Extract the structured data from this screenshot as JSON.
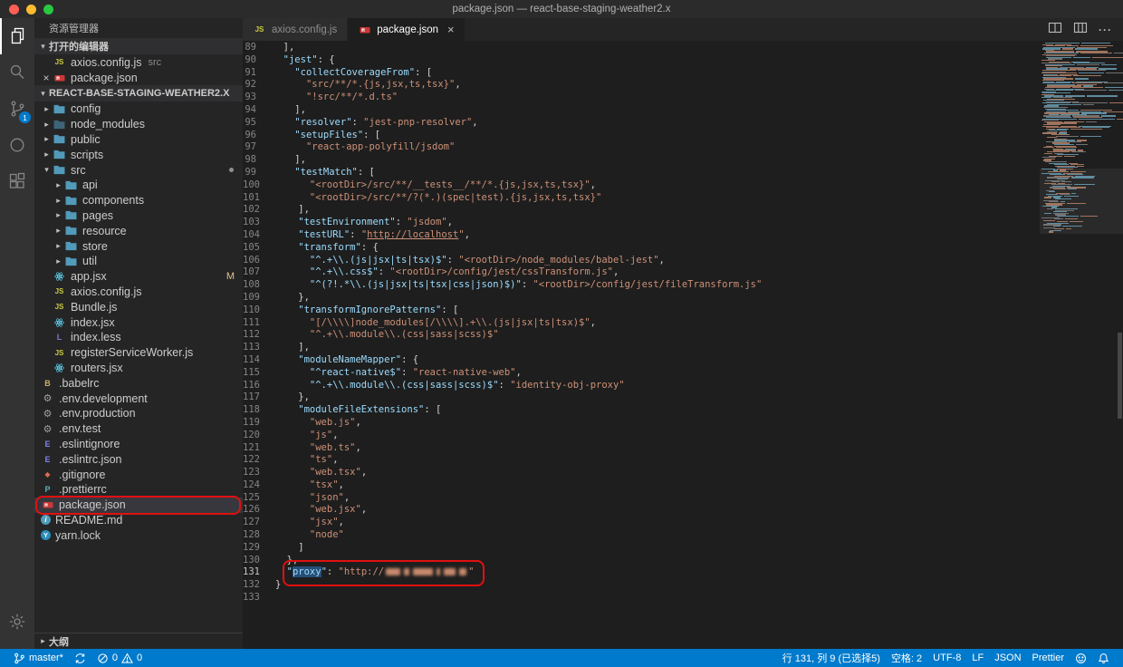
{
  "title_bar": {
    "title": "package.json — react-base-staging-weather2.x"
  },
  "activity_bar": {
    "scm_badge": "1"
  },
  "sidebar": {
    "title": "资源管理器",
    "sections": {
      "open_editors": "打开的编辑器",
      "outline": "大纲"
    },
    "root_label": "REACT-BASE-STAGING-WEATHER2.X",
    "open_editors": [
      {
        "icon": "js",
        "label": "axios.config.js",
        "detail": "src"
      },
      {
        "icon": "npm",
        "label": "package.json",
        "close": "×"
      }
    ],
    "tree": [
      {
        "icon": "folder",
        "label": "config",
        "indent": 0,
        "folder": true
      },
      {
        "icon": "folder",
        "label": "node_modules",
        "indent": 0,
        "folder": true,
        "dim": true
      },
      {
        "icon": "folder",
        "label": "public",
        "indent": 0,
        "folder": true
      },
      {
        "icon": "folder",
        "label": "scripts",
        "indent": 0,
        "folder": true
      },
      {
        "icon": "folder",
        "label": "src",
        "indent": 0,
        "folder": true,
        "open": true,
        "dot": true
      },
      {
        "icon": "folder",
        "label": "api",
        "indent": 1,
        "folder": true
      },
      {
        "icon": "folder",
        "label": "components",
        "indent": 1,
        "folder": true
      },
      {
        "icon": "folder",
        "label": "pages",
        "indent": 1,
        "folder": true
      },
      {
        "icon": "folder",
        "label": "resource",
        "indent": 1,
        "folder": true
      },
      {
        "icon": "folder",
        "label": "store",
        "indent": 1,
        "folder": true
      },
      {
        "icon": "folder",
        "label": "util",
        "indent": 1,
        "folder": true
      },
      {
        "icon": "react",
        "label": "app.jsx",
        "indent": 1,
        "badge": "M"
      },
      {
        "icon": "js",
        "label": "axios.config.js",
        "indent": 1
      },
      {
        "icon": "js",
        "label": "Bundle.js",
        "indent": 1
      },
      {
        "icon": "react",
        "label": "index.jsx",
        "indent": 1
      },
      {
        "icon": "less",
        "label": "index.less",
        "indent": 1
      },
      {
        "icon": "js",
        "label": "registerServiceWorker.js",
        "indent": 1
      },
      {
        "icon": "react",
        "label": "routers.jsx",
        "indent": 1
      },
      {
        "icon": "babel",
        "label": ".babelrc",
        "indent": 0
      },
      {
        "icon": "gear",
        "label": ".env.development",
        "indent": 0
      },
      {
        "icon": "gear",
        "label": ".env.production",
        "indent": 0
      },
      {
        "icon": "gear",
        "label": ".env.test",
        "indent": 0
      },
      {
        "icon": "eslint",
        "label": ".eslintignore",
        "indent": 0
      },
      {
        "icon": "eslint",
        "label": ".eslintrc.json",
        "indent": 0
      },
      {
        "icon": "git",
        "label": ".gitignore",
        "indent": 0
      },
      {
        "icon": "prettier",
        "label": ".prettierrc",
        "indent": 0
      },
      {
        "icon": "npm",
        "label": "package.json",
        "indent": 0,
        "selected": true,
        "annotated": true
      },
      {
        "icon": "readme",
        "label": "README.md",
        "indent": 0
      },
      {
        "icon": "yarn",
        "label": "yarn.lock",
        "indent": 0
      }
    ]
  },
  "tabs": [
    {
      "icon": "js",
      "label": "axios.config.js",
      "active": false
    },
    {
      "icon": "npm",
      "label": "package.json",
      "active": true,
      "close": "×"
    }
  ],
  "editor": {
    "lines": [
      {
        "n": 89,
        "t": [
          [
            "p",
            "  ],"
          ]
        ]
      },
      {
        "n": 90,
        "t": [
          [
            "p",
            "  "
          ],
          [
            "k",
            "\"jest\""
          ],
          [
            "p",
            ": {"
          ]
        ]
      },
      {
        "n": 91,
        "t": [
          [
            "p",
            "    "
          ],
          [
            "k",
            "\"collectCoverageFrom\""
          ],
          [
            "p",
            ": ["
          ]
        ]
      },
      {
        "n": 92,
        "t": [
          [
            "p",
            "      "
          ],
          [
            "s",
            "\"src/**/*.{js,jsx,ts,tsx}\""
          ],
          [
            "p",
            ","
          ]
        ]
      },
      {
        "n": 93,
        "t": [
          [
            "p",
            "      "
          ],
          [
            "s",
            "\"!src/**/*.d.ts\""
          ]
        ]
      },
      {
        "n": 94,
        "t": [
          [
            "p",
            "    ],"
          ]
        ]
      },
      {
        "n": 95,
        "t": [
          [
            "p",
            "    "
          ],
          [
            "k",
            "\"resolver\""
          ],
          [
            "p",
            ": "
          ],
          [
            "s",
            "\"jest-pnp-resolver\""
          ],
          [
            "p",
            ","
          ]
        ]
      },
      {
        "n": 96,
        "t": [
          [
            "p",
            "    "
          ],
          [
            "k",
            "\"setupFiles\""
          ],
          [
            "p",
            ": ["
          ]
        ]
      },
      {
        "n": 97,
        "t": [
          [
            "p",
            "      "
          ],
          [
            "s",
            "\"react-app-polyfill/jsdom\""
          ]
        ]
      },
      {
        "n": 98,
        "t": [
          [
            "p",
            "    ],"
          ]
        ]
      },
      {
        "n": 99,
        "t": [
          [
            "p",
            "    "
          ],
          [
            "k",
            "\"testMatch\""
          ],
          [
            "p",
            ": ["
          ]
        ]
      },
      {
        "n": 100,
        "t": [
          [
            "p",
            "      "
          ],
          [
            "s",
            "\"<rootDir>/src/**/__tests__/**/*.{js,jsx,ts,tsx}\""
          ],
          [
            "p",
            ","
          ]
        ]
      },
      {
        "n": 101,
        "t": [
          [
            "p",
            "      "
          ],
          [
            "s",
            "\"<rootDir>/src/**/?(*.)(spec|test).{js,jsx,ts,tsx}\""
          ]
        ]
      },
      {
        "n": 102,
        "t": [
          [
            "p",
            "    ],"
          ]
        ]
      },
      {
        "n": 103,
        "t": [
          [
            "p",
            "    "
          ],
          [
            "k",
            "\"testEnvironment\""
          ],
          [
            "p",
            ": "
          ],
          [
            "s",
            "\"jsdom\""
          ],
          [
            "p",
            ","
          ]
        ]
      },
      {
        "n": 104,
        "t": [
          [
            "p",
            "    "
          ],
          [
            "k",
            "\"testURL\""
          ],
          [
            "p",
            ": "
          ],
          [
            "s",
            "\""
          ],
          [
            "l",
            "http://localhost"
          ],
          [
            "s",
            "\""
          ],
          [
            "p",
            ","
          ]
        ]
      },
      {
        "n": 105,
        "t": [
          [
            "p",
            "    "
          ],
          [
            "k",
            "\"transform\""
          ],
          [
            "p",
            ": {"
          ]
        ]
      },
      {
        "n": 106,
        "t": [
          [
            "p",
            "      "
          ],
          [
            "k",
            "\"^.+\\\\.(js|jsx|ts|tsx)$\""
          ],
          [
            "p",
            ": "
          ],
          [
            "s",
            "\"<rootDir>/node_modules/babel-jest\""
          ],
          [
            "p",
            ","
          ]
        ]
      },
      {
        "n": 107,
        "t": [
          [
            "p",
            "      "
          ],
          [
            "k",
            "\"^.+\\\\.css$\""
          ],
          [
            "p",
            ": "
          ],
          [
            "s",
            "\"<rootDir>/config/jest/cssTransform.js\""
          ],
          [
            "p",
            ","
          ]
        ]
      },
      {
        "n": 108,
        "t": [
          [
            "p",
            "      "
          ],
          [
            "k",
            "\"^(?!.*\\\\.(js|jsx|ts|tsx|css|json)$)\""
          ],
          [
            "p",
            ": "
          ],
          [
            "s",
            "\"<rootDir>/config/jest/fileTransform.js\""
          ]
        ]
      },
      {
        "n": 109,
        "t": [
          [
            "p",
            "    },"
          ]
        ]
      },
      {
        "n": 110,
        "t": [
          [
            "p",
            "    "
          ],
          [
            "k",
            "\"transformIgnorePatterns\""
          ],
          [
            "p",
            ": ["
          ]
        ]
      },
      {
        "n": 111,
        "t": [
          [
            "p",
            "      "
          ],
          [
            "s",
            "\"[/\\\\\\\\]node_modules[/\\\\\\\\].+\\\\.(js|jsx|ts|tsx)$\""
          ],
          [
            "p",
            ","
          ]
        ]
      },
      {
        "n": 112,
        "t": [
          [
            "p",
            "      "
          ],
          [
            "s",
            "\"^.+\\\\.module\\\\.(css|sass|scss)$\""
          ]
        ]
      },
      {
        "n": 113,
        "t": [
          [
            "p",
            "    ],"
          ]
        ]
      },
      {
        "n": 114,
        "t": [
          [
            "p",
            "    "
          ],
          [
            "k",
            "\"moduleNameMapper\""
          ],
          [
            "p",
            ": {"
          ]
        ]
      },
      {
        "n": 115,
        "t": [
          [
            "p",
            "      "
          ],
          [
            "k",
            "\"^react-native$\""
          ],
          [
            "p",
            ": "
          ],
          [
            "s",
            "\"react-native-web\""
          ],
          [
            "p",
            ","
          ]
        ]
      },
      {
        "n": 116,
        "t": [
          [
            "p",
            "      "
          ],
          [
            "k",
            "\"^.+\\\\.module\\\\.(css|sass|scss)$\""
          ],
          [
            "p",
            ": "
          ],
          [
            "s",
            "\"identity-obj-proxy\""
          ]
        ]
      },
      {
        "n": 117,
        "t": [
          [
            "p",
            "    },"
          ]
        ]
      },
      {
        "n": 118,
        "t": [
          [
            "p",
            "    "
          ],
          [
            "k",
            "\"moduleFileExtensions\""
          ],
          [
            "p",
            ": ["
          ]
        ]
      },
      {
        "n": 119,
        "t": [
          [
            "p",
            "      "
          ],
          [
            "s",
            "\"web.js\""
          ],
          [
            "p",
            ","
          ]
        ]
      },
      {
        "n": 120,
        "t": [
          [
            "p",
            "      "
          ],
          [
            "s",
            "\"js\""
          ],
          [
            "p",
            ","
          ]
        ]
      },
      {
        "n": 121,
        "t": [
          [
            "p",
            "      "
          ],
          [
            "s",
            "\"web.ts\""
          ],
          [
            "p",
            ","
          ]
        ]
      },
      {
        "n": 122,
        "t": [
          [
            "p",
            "      "
          ],
          [
            "s",
            "\"ts\""
          ],
          [
            "p",
            ","
          ]
        ]
      },
      {
        "n": 123,
        "t": [
          [
            "p",
            "      "
          ],
          [
            "s",
            "\"web.tsx\""
          ],
          [
            "p",
            ","
          ]
        ]
      },
      {
        "n": 124,
        "t": [
          [
            "p",
            "      "
          ],
          [
            "s",
            "\"tsx\""
          ],
          [
            "p",
            ","
          ]
        ]
      },
      {
        "n": 125,
        "t": [
          [
            "p",
            "      "
          ],
          [
            "s",
            "\"json\""
          ],
          [
            "p",
            ","
          ]
        ]
      },
      {
        "n": 126,
        "t": [
          [
            "p",
            "      "
          ],
          [
            "s",
            "\"web.jsx\""
          ],
          [
            "p",
            ","
          ]
        ]
      },
      {
        "n": 127,
        "t": [
          [
            "p",
            "      "
          ],
          [
            "s",
            "\"jsx\""
          ],
          [
            "p",
            ","
          ]
        ]
      },
      {
        "n": 128,
        "t": [
          [
            "p",
            "      "
          ],
          [
            "s",
            "\"node\""
          ]
        ]
      },
      {
        "n": 129,
        "t": [
          [
            "p",
            "    ]"
          ]
        ]
      },
      {
        "n": 130,
        "t": [
          [
            "p",
            "  },"
          ]
        ]
      },
      {
        "n": 131,
        "boxStart": 1,
        "t": [
          [
            "p",
            "  "
          ],
          [
            "k",
            "\""
          ],
          [
            "S",
            "proxy"
          ],
          [
            "k",
            "\""
          ],
          [
            "p",
            ": "
          ],
          [
            "s",
            "\"http://"
          ],
          [
            "x",
            ""
          ],
          [
            "s",
            "\""
          ]
        ]
      },
      {
        "n": 132,
        "t": [
          [
            "p",
            "}"
          ]
        ]
      },
      {
        "n": 133,
        "t": []
      }
    ]
  },
  "status_bar": {
    "branch": "master*",
    "errors": "0",
    "warnings": "0",
    "cursor": "行 131, 列 9 (已选择5)",
    "indent": "空格: 2",
    "encoding": "UTF-8",
    "eol": "LF",
    "language": "JSON",
    "formatter": "Prettier"
  }
}
